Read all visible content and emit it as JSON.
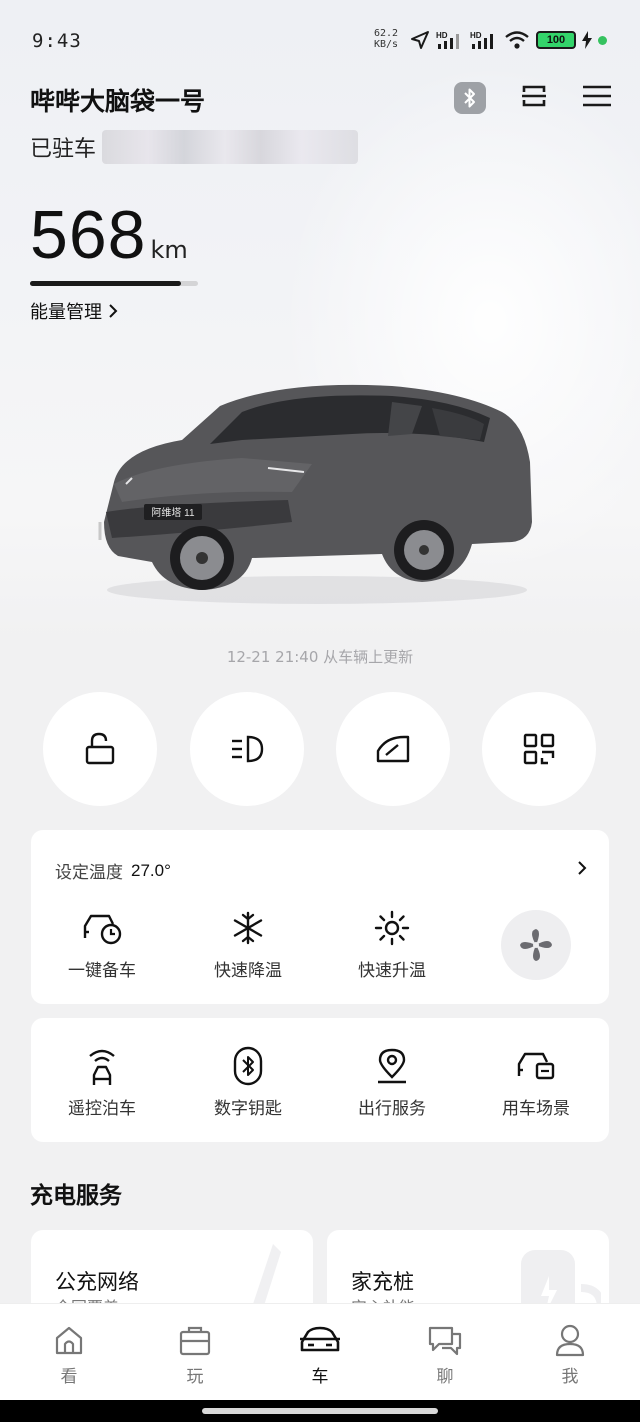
{
  "status_bar": {
    "time": "9:43",
    "net_speed_value": "62.2",
    "net_speed_unit": "KB/s",
    "battery": "100"
  },
  "header": {
    "car_name": "哔哔大脑袋一号",
    "parking_status": "已驻车"
  },
  "range": {
    "value": "568",
    "unit": "km",
    "fill_fraction": 0.9,
    "energy_link": "能量管理"
  },
  "car": {
    "badge": "阿维塔 11"
  },
  "updated": "12-21  21:40  从车辆上更新",
  "climate": {
    "label": "设定温度",
    "value": "27.0°",
    "functions": [
      {
        "label": "一键备车",
        "icon": "car-clock-icon"
      },
      {
        "label": "快速降温",
        "icon": "snowflake-icon"
      },
      {
        "label": "快速升温",
        "icon": "sun-icon"
      }
    ],
    "fan_icon": "fan-icon"
  },
  "controls": [
    {
      "label": "遥控泊车",
      "icon": "remote-parking-icon"
    },
    {
      "label": "数字钥匙",
      "icon": "digital-key-icon"
    },
    {
      "label": "出行服务",
      "icon": "location-pin-icon"
    },
    {
      "label": "用车场景",
      "icon": "car-scene-icon"
    }
  ],
  "charging": {
    "title": "充电服务",
    "cards": [
      {
        "title": "公充网络",
        "subtitle": "全国覆盖"
      },
      {
        "title": "家充桩",
        "subtitle": "安心补能"
      }
    ]
  },
  "tabs": [
    {
      "label": "看",
      "icon": "home-icon"
    },
    {
      "label": "玩",
      "icon": "bag-icon"
    },
    {
      "label": "车",
      "icon": "car-icon",
      "active": true
    },
    {
      "label": "聊",
      "icon": "chat-icon"
    },
    {
      "label": "我",
      "icon": "person-icon"
    }
  ]
}
